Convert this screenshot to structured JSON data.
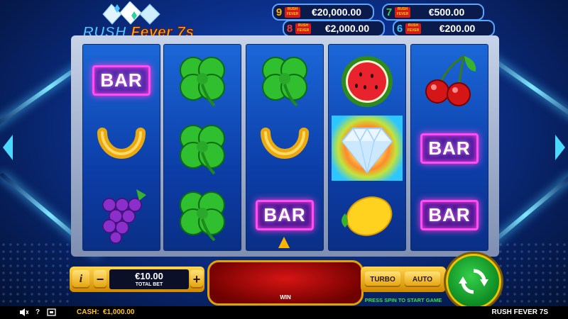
{
  "game": {
    "title": "RUSH FEVER 7S"
  },
  "logo": {
    "word1": "RUSH",
    "word2": "Fever 7s"
  },
  "jackpots": [
    {
      "num": "9",
      "amount": "€20,000.00",
      "num_color": "#ffb400"
    },
    {
      "num": "7",
      "amount": "€500.00",
      "num_color": "#3fd14a"
    },
    {
      "num": "8",
      "amount": "€2,000.00",
      "num_color": "#ff3b3b"
    },
    {
      "num": "6",
      "amount": "€200.00",
      "num_color": "#38c6ff"
    }
  ],
  "jackpot_tag": "RUSH FEVER",
  "reels": [
    [
      "bar",
      "horseshoe",
      "grapes"
    ],
    [
      "clover",
      "clover",
      "clover"
    ],
    [
      "clover",
      "horseshoe",
      "bar"
    ],
    [
      "watermelon",
      "diamond",
      "lemon"
    ],
    [
      "cherry",
      "bar",
      "bar"
    ]
  ],
  "symbol_text": {
    "bar": "BAR"
  },
  "controls": {
    "info": "i",
    "minus": "−",
    "plus": "+",
    "bet_value": "€10.00",
    "bet_label": "TOTAL BET",
    "win_label": "WIN",
    "turbo": "TURBO",
    "auto": "AUTO",
    "hint": "PRESS SPIN TO START GAME"
  },
  "footer": {
    "cash_label": "CASH:",
    "cash_value": "€1,000.00",
    "sound_icon": "sound-icon",
    "help": "?",
    "fullscreen_icon": "fullscreen-icon"
  },
  "colors": {
    "accent": "#ffb400",
    "spin_green": "#1fb53a",
    "bar_glow": "#ff3be8"
  }
}
